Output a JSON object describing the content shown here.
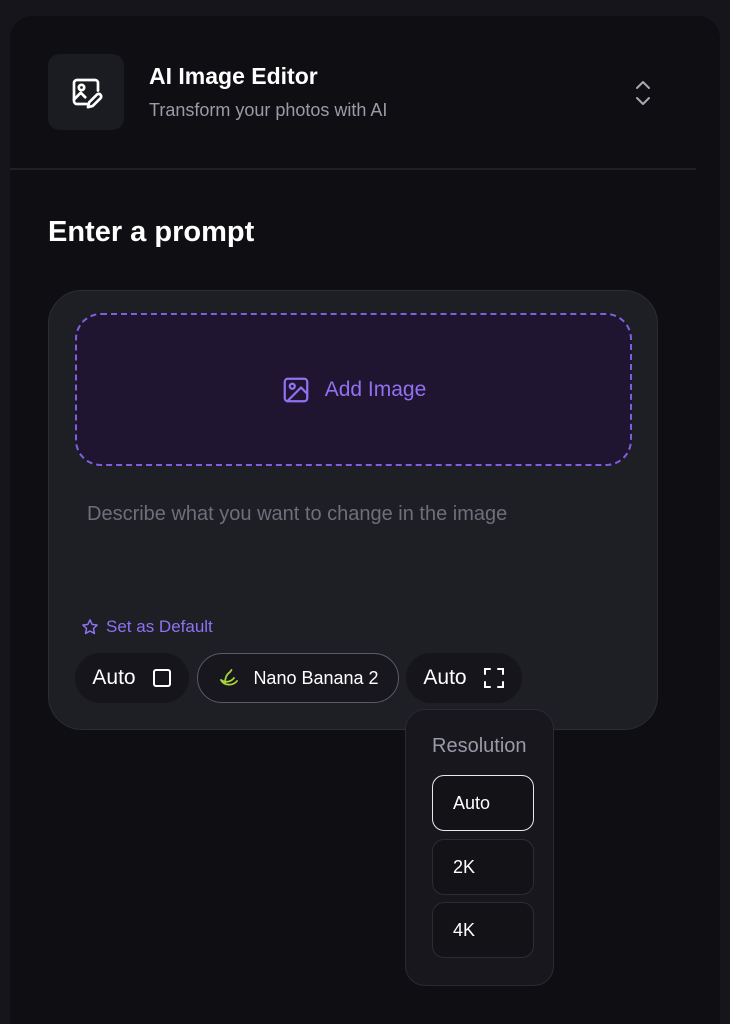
{
  "header": {
    "app_icon": "image-edit-icon",
    "title": "AI Image Editor",
    "subtitle": "Transform your photos with AI",
    "switch_icon": "chevrons-up-down-icon"
  },
  "main": {
    "section_title": "Enter a prompt",
    "add_image": {
      "label": "Add Image",
      "icon": "image-icon"
    },
    "prompt": {
      "placeholder": "Describe what you want to change in the image",
      "value": ""
    },
    "set_default": {
      "label": "Set as Default",
      "icon": "star-outline-icon"
    },
    "chips": {
      "aspect": {
        "label": "Auto",
        "icon": "square-icon"
      },
      "model": {
        "label": "Nano Banana 2",
        "icon": "banana-icon"
      },
      "resolution": {
        "label": "Auto",
        "icon": "expand-icon"
      }
    }
  },
  "resolution_dropdown": {
    "title": "Resolution",
    "options": [
      "Auto",
      "2K",
      "4K"
    ],
    "selected": "Auto"
  },
  "colors": {
    "accent": "#8e72f2",
    "accent_border": "#7d61dc",
    "background": "#0f0f13",
    "card": "#1e1e25",
    "banana": "#a6d63a"
  }
}
